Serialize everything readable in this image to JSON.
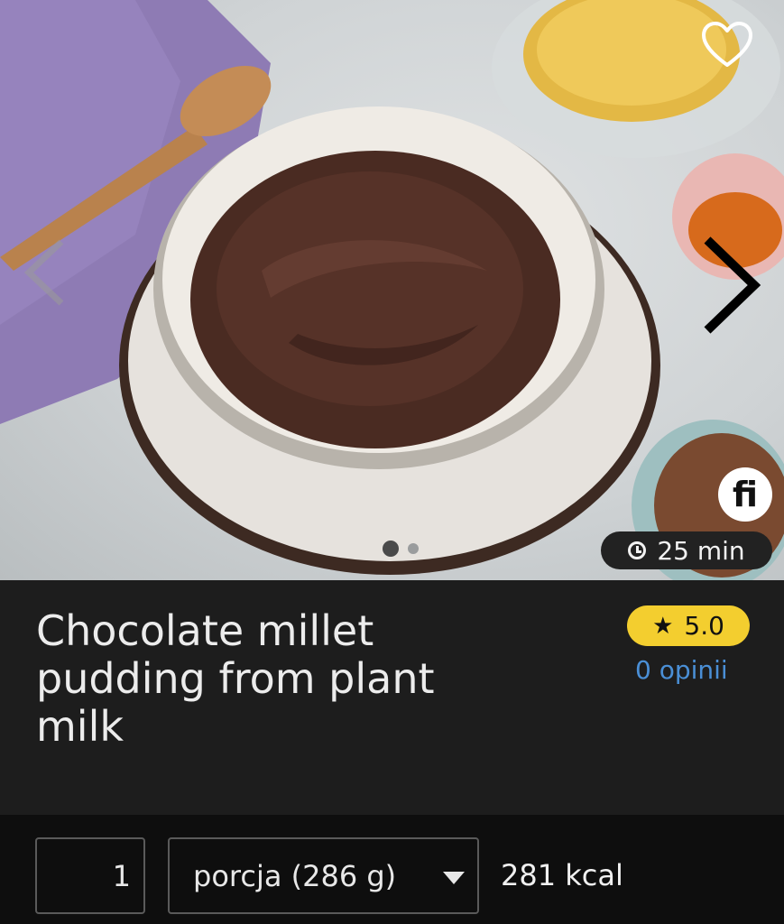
{
  "hero": {
    "duration": "25 min",
    "logo_text": "fi",
    "carousel": {
      "current": 1,
      "total": 2
    }
  },
  "recipe": {
    "title": "Chocolate millet pudding from plant milk",
    "rating": "5.0",
    "reviews": "0 opinii"
  },
  "portion": {
    "quantity": "1",
    "unit": "porcja (286 g)",
    "calories": "281 kcal"
  },
  "colors": {
    "background": "#1d1d1d",
    "bottom_bar": "#0e0e0e",
    "rating_badge": "#f3ce2f",
    "link": "#4a8fd6"
  },
  "icons": {
    "favorite": "heart-outline-icon",
    "previous": "chevron-left-icon",
    "next": "chevron-right-icon",
    "time": "clock-icon",
    "rating": "star-icon",
    "dropdown": "caret-down-icon"
  }
}
